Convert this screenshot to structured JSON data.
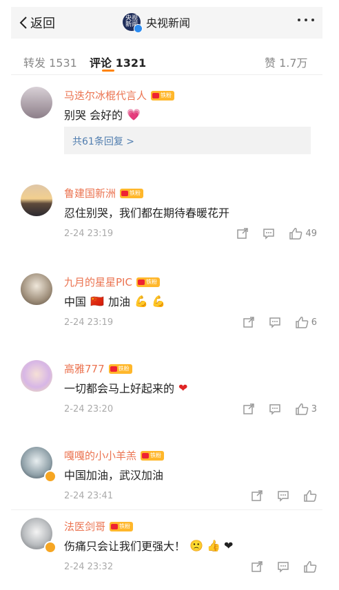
{
  "header": {
    "back_label": "返回",
    "account_name": "央视新闻",
    "account_logo_text": "央视新闻"
  },
  "tabs": [
    {
      "label": "转发 1531"
    },
    {
      "label": "评论 1321"
    },
    {
      "label": "赞 1.7万"
    }
  ],
  "badge_label": "铁粉",
  "comments": [
    {
      "name": "马迭尔冰棍代言人",
      "text": "别哭 会好的",
      "emoji": "💗",
      "reply_label": "共61条回复 >"
    },
    {
      "name": "鲁建国新洲",
      "text": "忍住别哭，我们都在期待春暖花开",
      "time": "2-24 23:19",
      "likes": "49"
    },
    {
      "name": "九月的星星PIC",
      "text_a": "中国",
      "text_flag": "🇨🇳",
      "text_b": "加油",
      "emoji": "💪 💪",
      "time": "2-24 23:19",
      "likes": "6"
    },
    {
      "name": "高雅777",
      "text": "一切都会马上好起来的",
      "emoji": "❤",
      "time": "2-24 23:20",
      "likes": "3"
    },
    {
      "name": "嘎嘎的小小羊羔",
      "text": "中国加油，武汉加油",
      "time": "2-24 23:41"
    },
    {
      "name": "法医剑哥",
      "text": "伤痛只会让我们更强大！",
      "emoji": "🙁 👍 ❤",
      "time": "2-24 23:32"
    }
  ]
}
